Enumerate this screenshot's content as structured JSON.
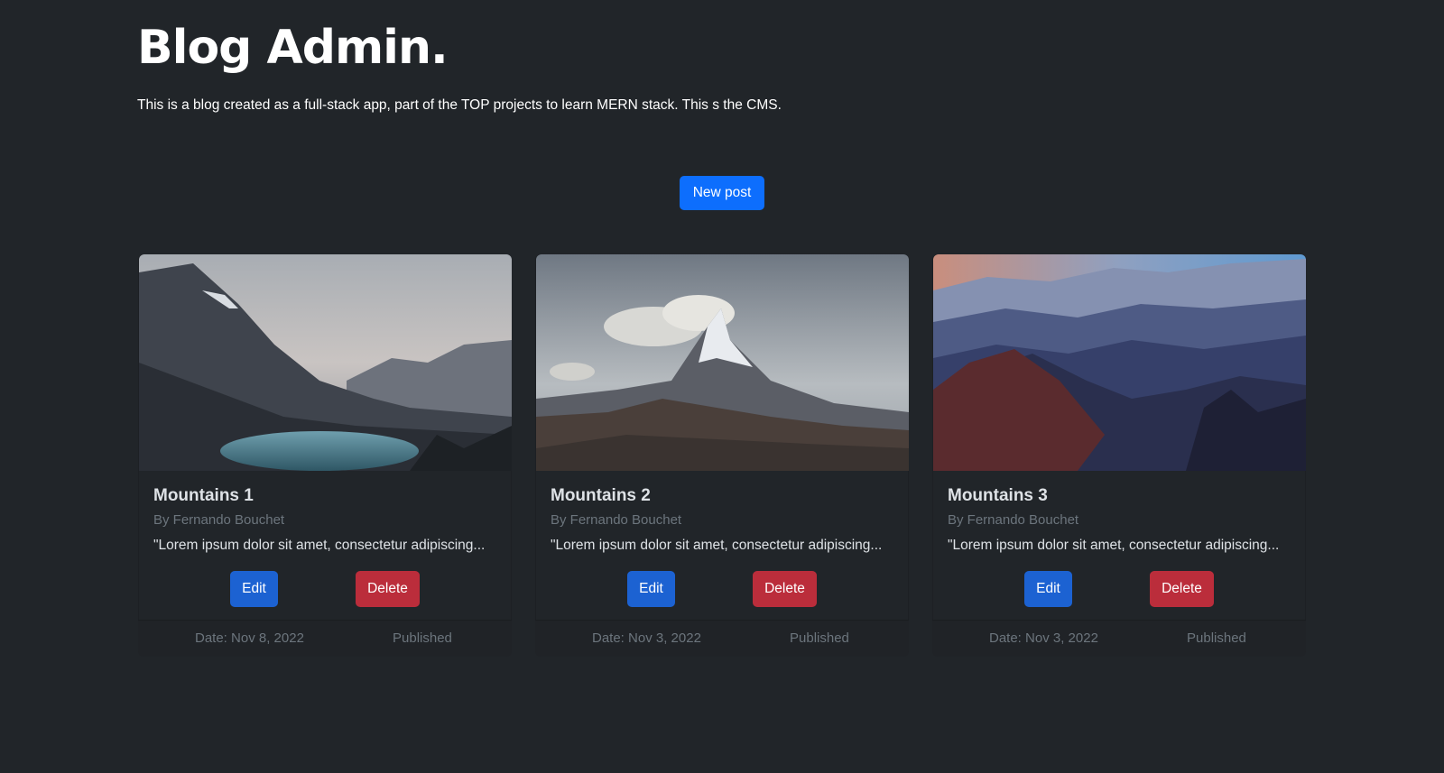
{
  "header": {
    "title": "Blog Admin.",
    "description": "This is a blog created as a full-stack app, part of the TOP projects to learn MERN stack. This s the CMS."
  },
  "actions": {
    "new_post_label": "New post"
  },
  "colors": {
    "background": "#212529",
    "primary": "#0d6efd",
    "danger": "#bb2d3b",
    "muted": "#6c757d"
  },
  "posts": [
    {
      "image": "mountain-lake-photo",
      "title": "Mountains 1",
      "author": "By Fernando Bouchet",
      "excerpt": "\"Lorem ipsum dolor sit amet, consectetur adipiscing...",
      "edit_label": "Edit",
      "delete_label": "Delete",
      "date": "Date: Nov 8, 2022",
      "status": "Published"
    },
    {
      "image": "matterhorn-photo",
      "title": "Mountains 2",
      "author": "By Fernando Bouchet",
      "excerpt": "\"Lorem ipsum dolor sit amet, consectetur adipiscing...",
      "edit_label": "Edit",
      "delete_label": "Delete",
      "date": "Date: Nov 3, 2022",
      "status": "Published"
    },
    {
      "image": "mountain-range-sunset-photo",
      "title": "Mountains 3",
      "author": "By Fernando Bouchet",
      "excerpt": "\"Lorem ipsum dolor sit amet, consectetur adipiscing...",
      "edit_label": "Edit",
      "delete_label": "Delete",
      "date": "Date: Nov 3, 2022",
      "status": "Published"
    }
  ]
}
